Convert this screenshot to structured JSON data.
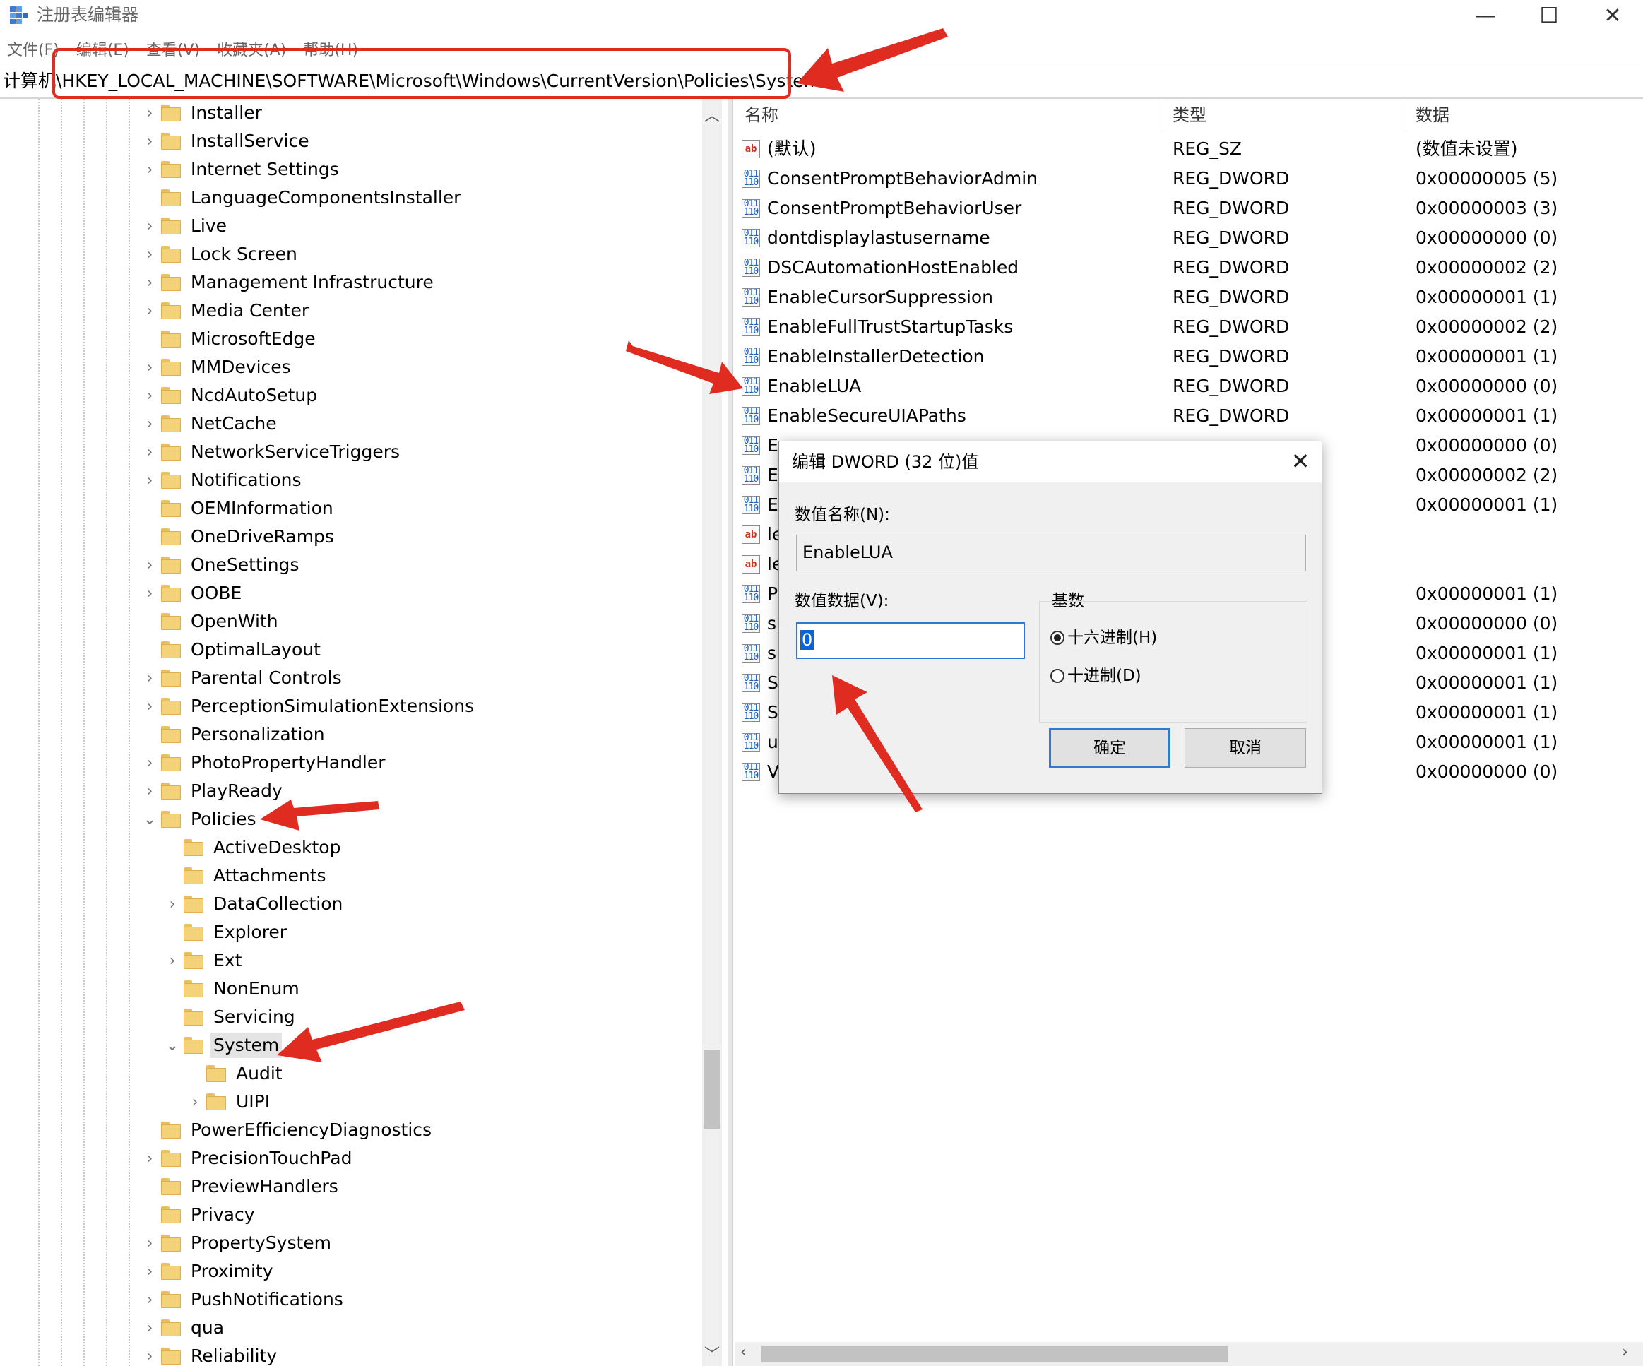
{
  "window": {
    "title": "注册表编辑器",
    "controls": {
      "minimize": "—",
      "maximize": "☐",
      "close": "✕"
    }
  },
  "menu": [
    "文件(F)",
    "编辑(E)",
    "查看(V)",
    "收藏夹(A)",
    "帮助(H)"
  ],
  "address": "计算机\\HKEY_LOCAL_MACHINE\\SOFTWARE\\Microsoft\\Windows\\CurrentVersion\\Policies\\System",
  "tree": {
    "items": [
      {
        "label": "Installer",
        "depth": 0,
        "expander": "collapsed"
      },
      {
        "label": "InstallService",
        "depth": 0,
        "expander": "collapsed"
      },
      {
        "label": "Internet Settings",
        "depth": 0,
        "expander": "collapsed"
      },
      {
        "label": "LanguageComponentsInstaller",
        "depth": 0,
        "expander": "none"
      },
      {
        "label": "Live",
        "depth": 0,
        "expander": "collapsed"
      },
      {
        "label": "Lock Screen",
        "depth": 0,
        "expander": "collapsed"
      },
      {
        "label": "Management Infrastructure",
        "depth": 0,
        "expander": "collapsed"
      },
      {
        "label": "Media Center",
        "depth": 0,
        "expander": "collapsed"
      },
      {
        "label": "MicrosoftEdge",
        "depth": 0,
        "expander": "none"
      },
      {
        "label": "MMDevices",
        "depth": 0,
        "expander": "collapsed"
      },
      {
        "label": "NcdAutoSetup",
        "depth": 0,
        "expander": "collapsed"
      },
      {
        "label": "NetCache",
        "depth": 0,
        "expander": "collapsed"
      },
      {
        "label": "NetworkServiceTriggers",
        "depth": 0,
        "expander": "collapsed"
      },
      {
        "label": "Notifications",
        "depth": 0,
        "expander": "collapsed"
      },
      {
        "label": "OEMInformation",
        "depth": 0,
        "expander": "none"
      },
      {
        "label": "OneDriveRamps",
        "depth": 0,
        "expander": "none"
      },
      {
        "label": "OneSettings",
        "depth": 0,
        "expander": "collapsed"
      },
      {
        "label": "OOBE",
        "depth": 0,
        "expander": "collapsed"
      },
      {
        "label": "OpenWith",
        "depth": 0,
        "expander": "none"
      },
      {
        "label": "OptimalLayout",
        "depth": 0,
        "expander": "none"
      },
      {
        "label": "Parental Controls",
        "depth": 0,
        "expander": "collapsed"
      },
      {
        "label": "PerceptionSimulationExtensions",
        "depth": 0,
        "expander": "collapsed"
      },
      {
        "label": "Personalization",
        "depth": 0,
        "expander": "none"
      },
      {
        "label": "PhotoPropertyHandler",
        "depth": 0,
        "expander": "collapsed"
      },
      {
        "label": "PlayReady",
        "depth": 0,
        "expander": "collapsed"
      },
      {
        "label": "Policies",
        "depth": 0,
        "expander": "expanded"
      },
      {
        "label": "ActiveDesktop",
        "depth": 1,
        "expander": "none"
      },
      {
        "label": "Attachments",
        "depth": 1,
        "expander": "none"
      },
      {
        "label": "DataCollection",
        "depth": 1,
        "expander": "collapsed"
      },
      {
        "label": "Explorer",
        "depth": 1,
        "expander": "none"
      },
      {
        "label": "Ext",
        "depth": 1,
        "expander": "collapsed"
      },
      {
        "label": "NonEnum",
        "depth": 1,
        "expander": "none"
      },
      {
        "label": "Servicing",
        "depth": 1,
        "expander": "none"
      },
      {
        "label": "System",
        "depth": 1,
        "expander": "expanded",
        "selected": true
      },
      {
        "label": "Audit",
        "depth": 2,
        "expander": "none"
      },
      {
        "label": "UIPI",
        "depth": 2,
        "expander": "collapsed"
      },
      {
        "label": "PowerEfficiencyDiagnostics",
        "depth": 0,
        "expander": "none"
      },
      {
        "label": "PrecisionTouchPad",
        "depth": 0,
        "expander": "collapsed"
      },
      {
        "label": "PreviewHandlers",
        "depth": 0,
        "expander": "none"
      },
      {
        "label": "Privacy",
        "depth": 0,
        "expander": "none"
      },
      {
        "label": "PropertySystem",
        "depth": 0,
        "expander": "collapsed"
      },
      {
        "label": "Proximity",
        "depth": 0,
        "expander": "collapsed"
      },
      {
        "label": "PushNotifications",
        "depth": 0,
        "expander": "collapsed"
      },
      {
        "label": "qua",
        "depth": 0,
        "expander": "collapsed"
      },
      {
        "label": "Reliability",
        "depth": 0,
        "expander": "collapsed"
      }
    ]
  },
  "list": {
    "headers": {
      "name": "名称",
      "type": "类型",
      "data": "数据"
    },
    "rows": [
      {
        "icon": "string-value-icon",
        "name": "(默认)",
        "type": "REG_SZ",
        "data": "(数值未设置)"
      },
      {
        "icon": "dword-value-icon",
        "name": "ConsentPromptBehaviorAdmin",
        "type": "REG_DWORD",
        "data": "0x00000005 (5)"
      },
      {
        "icon": "dword-value-icon",
        "name": "ConsentPromptBehaviorUser",
        "type": "REG_DWORD",
        "data": "0x00000003 (3)"
      },
      {
        "icon": "dword-value-icon",
        "name": "dontdisplaylastusername",
        "type": "REG_DWORD",
        "data": "0x00000000 (0)"
      },
      {
        "icon": "dword-value-icon",
        "name": "DSCAutomationHostEnabled",
        "type": "REG_DWORD",
        "data": "0x00000002 (2)"
      },
      {
        "icon": "dword-value-icon",
        "name": "EnableCursorSuppression",
        "type": "REG_DWORD",
        "data": "0x00000001 (1)"
      },
      {
        "icon": "dword-value-icon",
        "name": "EnableFullTrustStartupTasks",
        "type": "REG_DWORD",
        "data": "0x00000002 (2)"
      },
      {
        "icon": "dword-value-icon",
        "name": "EnableInstallerDetection",
        "type": "REG_DWORD",
        "data": "0x00000001 (1)"
      },
      {
        "icon": "dword-value-icon",
        "name": "EnableLUA",
        "type": "REG_DWORD",
        "data": "0x00000000 (0)"
      },
      {
        "icon": "dword-value-icon",
        "name": "EnableSecureUIAPaths",
        "type": "REG_DWORD",
        "data": "0x00000001 (1)"
      },
      {
        "icon": "dword-value-icon",
        "name": "E",
        "type": "",
        "data": "0x00000000 (0)"
      },
      {
        "icon": "dword-value-icon",
        "name": "E",
        "type": "",
        "data": "0x00000002 (2)"
      },
      {
        "icon": "dword-value-icon",
        "name": "E",
        "type": "",
        "data": "0x00000001 (1)"
      },
      {
        "icon": "string-value-icon",
        "name": "le",
        "type": "",
        "data": ""
      },
      {
        "icon": "string-value-icon",
        "name": "le",
        "type": "",
        "data": ""
      },
      {
        "icon": "dword-value-icon",
        "name": "P",
        "type": "",
        "data": "0x00000001 (1)"
      },
      {
        "icon": "dword-value-icon",
        "name": "s",
        "type": "",
        "data": "0x00000000 (0)"
      },
      {
        "icon": "dword-value-icon",
        "name": "s",
        "type": "",
        "data": "0x00000001 (1)"
      },
      {
        "icon": "dword-value-icon",
        "name": "S",
        "type": "",
        "data": "0x00000001 (1)"
      },
      {
        "icon": "dword-value-icon",
        "name": "S",
        "type": "",
        "data": "0x00000001 (1)"
      },
      {
        "icon": "dword-value-icon",
        "name": "u",
        "type": "",
        "data": "0x00000001 (1)"
      },
      {
        "icon": "dword-value-icon",
        "name": "V",
        "type": "",
        "data": "0x00000000 (0)"
      }
    ]
  },
  "dialog": {
    "title": "编辑 DWORD (32 位)值",
    "name_label": "数值名称(N):",
    "name_value": "EnableLUA",
    "data_label": "数值数据(V):",
    "data_value": "0",
    "base_label": "基数",
    "radio_hex": "十六进制(H)",
    "radio_dec": "十进制(D)",
    "selected_base": "hex",
    "ok": "确定",
    "cancel": "取消",
    "close": "✕"
  },
  "colors": {
    "annotation": "#e02b20",
    "selection": "#0a64d6",
    "focus_border": "#2d7ad6"
  }
}
